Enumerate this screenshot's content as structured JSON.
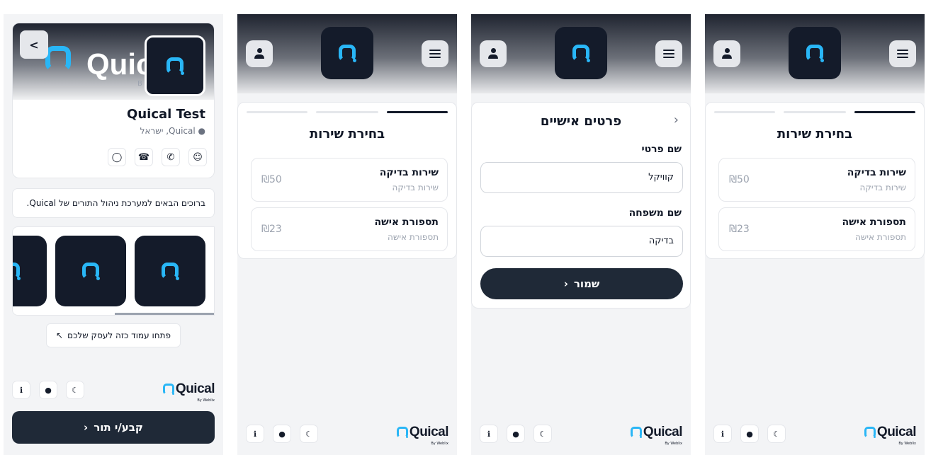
{
  "brand": {
    "name": "Quical",
    "by": "By Weblix",
    "accent": "#29b6f6",
    "dark": "#141b2a"
  },
  "profile": {
    "cover_word": "Quic",
    "cover_by": "B",
    "name": "Quical Test",
    "location": "Quical, ישראל",
    "welcome": "ברוכים הבאים למערכת ניהול התורים של Quical.",
    "open_page": "פתחו עמוד כזה לעסק שלכם",
    "book": "קבע/י תור",
    "share_icon": "share-icon",
    "socials": [
      "waze-icon",
      "phone-icon",
      "whatsapp-icon",
      "instagram-icon"
    ]
  },
  "services": {
    "title": "בחירת שירות",
    "items": [
      {
        "name": "שירות בדיקה",
        "sub": "שירות בדיקה",
        "price": "₪50"
      },
      {
        "name": "תספורת אישה",
        "sub": "תספורת אישה",
        "price": "₪23"
      }
    ]
  },
  "personal": {
    "title": "פרטים אישיים",
    "first_label": "שם פרטי",
    "first_value": "קוויקל",
    "last_label": "שם משפחה",
    "last_value": "בדיקה",
    "save": "שמור"
  },
  "footer_icons": [
    "info-icon",
    "globe-icon",
    "moon-icon"
  ]
}
